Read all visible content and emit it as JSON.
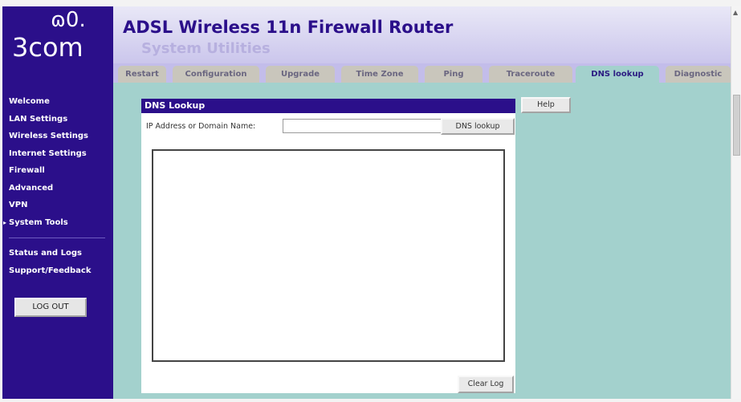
{
  "brand": {
    "logo_mark": "ɷ0.",
    "logo_text": "3com"
  },
  "header": {
    "title": "ADSL Wireless 11n Firewall Router",
    "subtitle": "System Utilities"
  },
  "sidebar": {
    "items": [
      {
        "label": "Welcome"
      },
      {
        "label": "LAN Settings"
      },
      {
        "label": "Wireless Settings"
      },
      {
        "label": "Internet Settings"
      },
      {
        "label": "Firewall"
      },
      {
        "label": "Advanced"
      },
      {
        "label": "VPN"
      },
      {
        "label": "System Tools",
        "active": true
      }
    ],
    "secondary": [
      {
        "label": "Status and Logs"
      },
      {
        "label": "Support/Feedback"
      }
    ],
    "logout_label": "LOG OUT"
  },
  "tabs": [
    {
      "label": "Restart"
    },
    {
      "label": "Configuration"
    },
    {
      "label": "Upgrade"
    },
    {
      "label": "Time Zone"
    },
    {
      "label": "Ping"
    },
    {
      "label": "Traceroute"
    },
    {
      "label": "DNS lookup",
      "active": true
    },
    {
      "label": "Diagnostic"
    }
  ],
  "panel": {
    "title": "DNS Lookup",
    "field_label": "IP Address or Domain Name:",
    "field_value": "",
    "lookup_button": "DNS lookup",
    "log_text": "",
    "clear_button": "Clear Log"
  },
  "help_button": "Help",
  "colors": {
    "nav_background": "#2b0f8a",
    "content_background": "#a3d1cd",
    "header_title": "#2b0f8a",
    "tab_inactive": "#c9c6bc"
  }
}
